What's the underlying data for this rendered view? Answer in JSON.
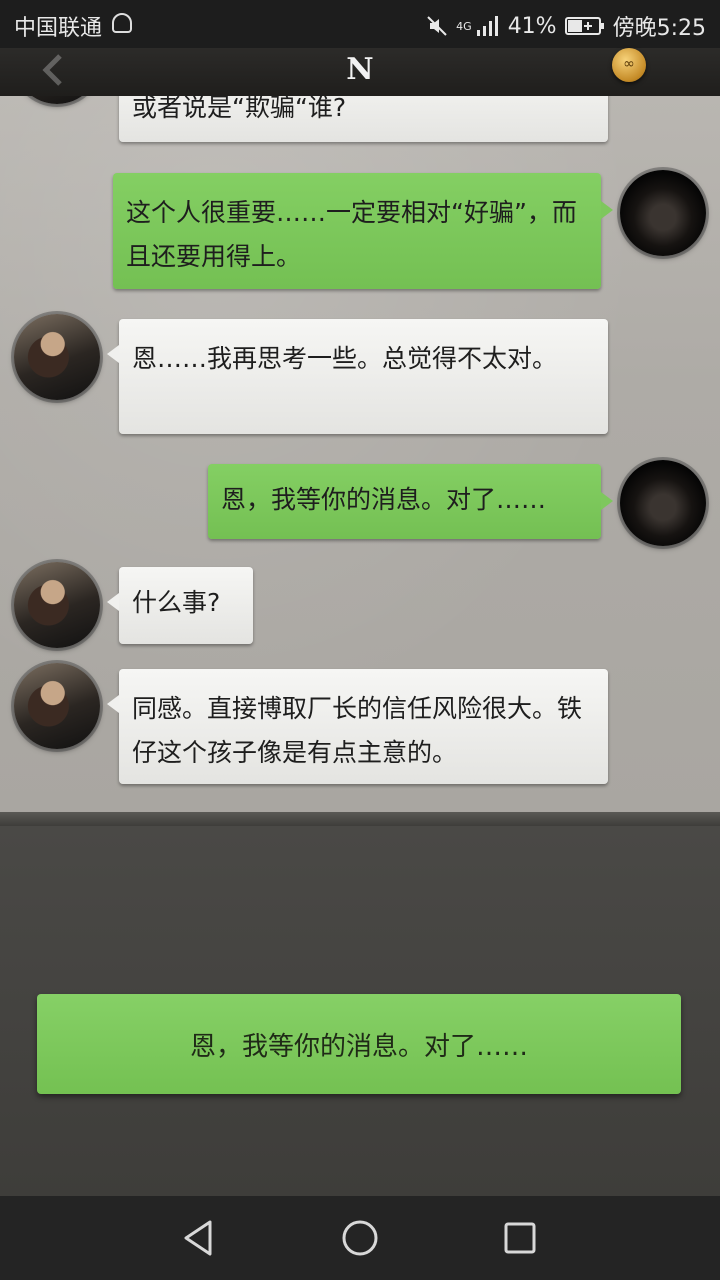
{
  "status_bar": {
    "carrier": "中国联通",
    "network_type": "4G",
    "battery_percent": "41%",
    "time": "傍晚5:25"
  },
  "title_bar": {
    "logo_letter": "N",
    "icons": [
      "back-chevron-icon",
      "coin-badge-icon"
    ]
  },
  "messages": [
    {
      "sender": "other",
      "text": "或者说是“欺骗“谁?"
    },
    {
      "sender": "self",
      "text": "这个人很重要……一定要相对“好骗”，而且还要用得上。"
    },
    {
      "sender": "other",
      "text": "恩……我再思考一些。总觉得不太对。"
    },
    {
      "sender": "self",
      "text": "恩，我等你的消息。对了……"
    },
    {
      "sender": "other",
      "text": "什么事?"
    },
    {
      "sender": "other",
      "text": "同感。直接博取厂长的信任风险很大。铁仔这个孩子像是有点主意的。"
    }
  ],
  "reply_option": {
    "text": "恩，我等你的消息。对了……"
  },
  "nav_bar": {
    "icons": [
      "back-triangle-icon",
      "home-circle-icon",
      "recent-square-icon"
    ]
  },
  "colors": {
    "self_bubble": "#7ec75d",
    "other_bubble": "#f0f0ee",
    "chat_background": "#aeaba6",
    "reply_area": "#3e3d3a"
  }
}
